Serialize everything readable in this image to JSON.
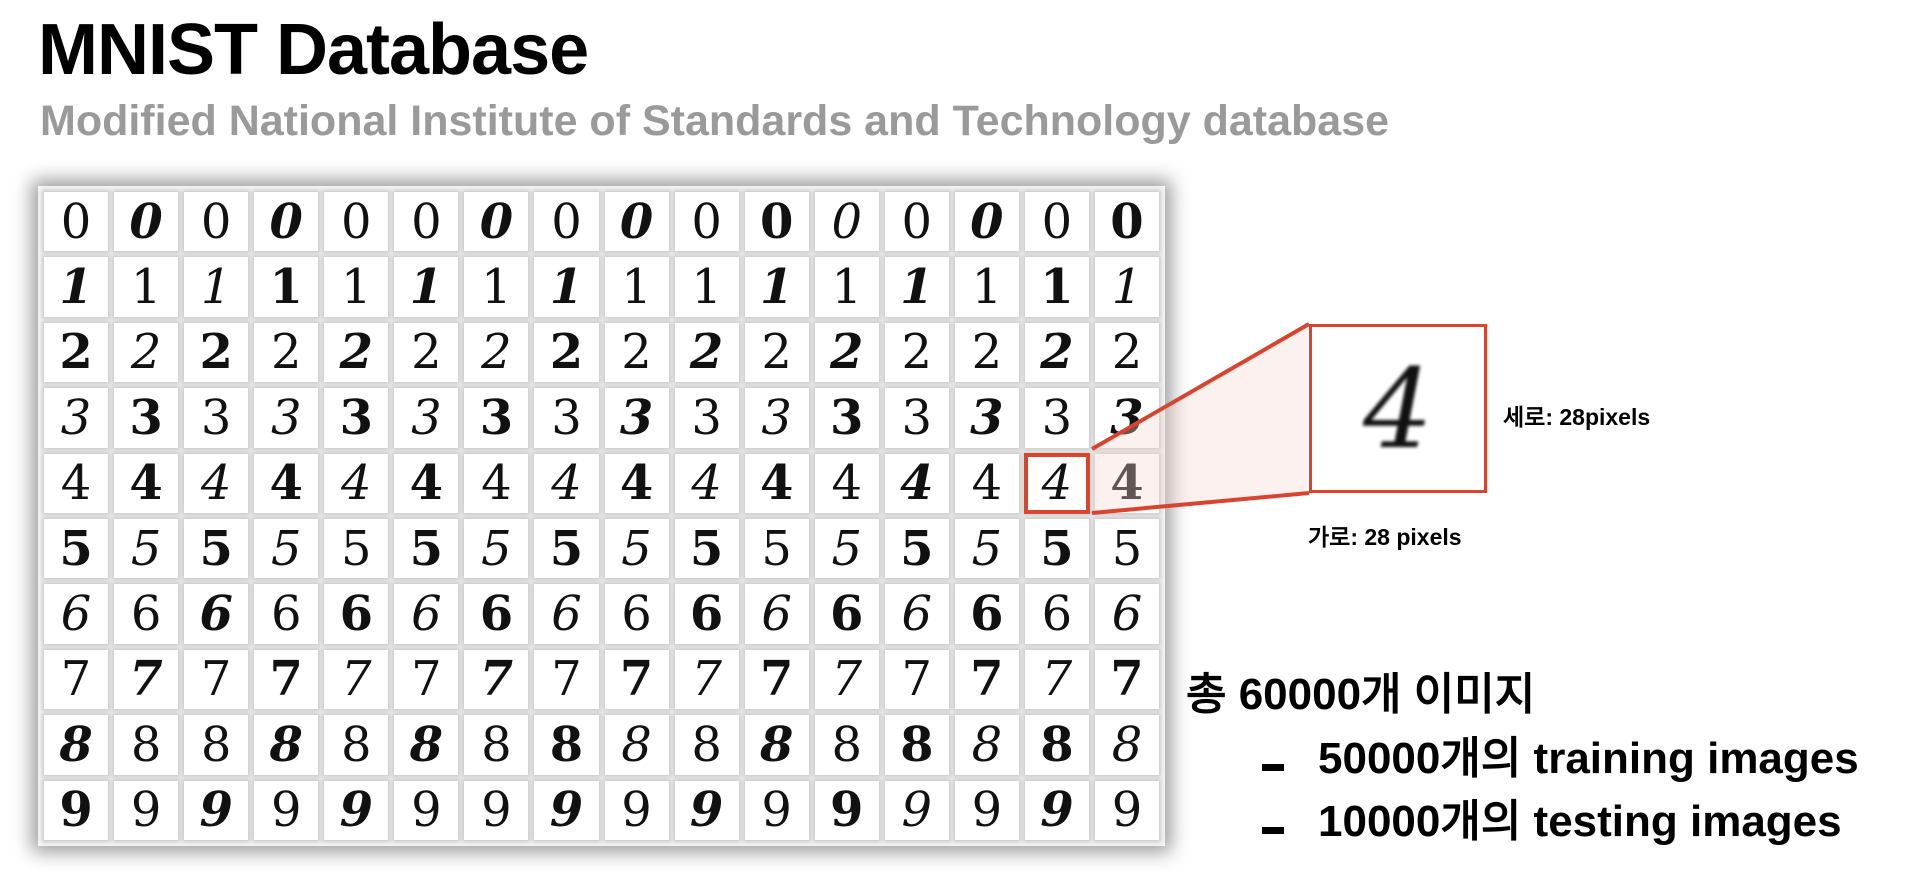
{
  "title": "MNIST Database",
  "subtitle": "Modified National Institute of Standards and Technology database",
  "grid": {
    "rows": [
      [
        "0",
        "0",
        "0",
        "0",
        "0",
        "0",
        "0",
        "0",
        "0",
        "0",
        "0",
        "0",
        "0",
        "0",
        "0",
        "0"
      ],
      [
        "1",
        "1",
        "1",
        "1",
        "1",
        "1",
        "1",
        "1",
        "1",
        "1",
        "1",
        "1",
        "1",
        "1",
        "1",
        "1"
      ],
      [
        "2",
        "2",
        "2",
        "2",
        "2",
        "2",
        "2",
        "2",
        "2",
        "2",
        "2",
        "2",
        "2",
        "2",
        "2",
        "2"
      ],
      [
        "3",
        "3",
        "3",
        "3",
        "3",
        "3",
        "3",
        "3",
        "3",
        "3",
        "3",
        "3",
        "3",
        "3",
        "3",
        "3"
      ],
      [
        "4",
        "4",
        "4",
        "4",
        "4",
        "4",
        "4",
        "4",
        "4",
        "4",
        "4",
        "4",
        "4",
        "4",
        "4",
        "4"
      ],
      [
        "5",
        "5",
        "5",
        "5",
        "5",
        "5",
        "5",
        "5",
        "5",
        "5",
        "5",
        "5",
        "5",
        "5",
        "5",
        "5"
      ],
      [
        "6",
        "6",
        "6",
        "6",
        "6",
        "6",
        "6",
        "6",
        "6",
        "6",
        "6",
        "6",
        "6",
        "6",
        "6",
        "6"
      ],
      [
        "7",
        "7",
        "7",
        "7",
        "7",
        "7",
        "7",
        "7",
        "7",
        "7",
        "7",
        "7",
        "7",
        "7",
        "7",
        "7"
      ],
      [
        "8",
        "8",
        "8",
        "8",
        "8",
        "8",
        "8",
        "8",
        "8",
        "8",
        "8",
        "8",
        "8",
        "8",
        "8",
        "8"
      ],
      [
        "9",
        "9",
        "9",
        "9",
        "9",
        "9",
        "9",
        "9",
        "9",
        "9",
        "9",
        "9",
        "9",
        "9",
        "9",
        "9"
      ]
    ],
    "highlight_color": "#d9442f"
  },
  "zoom": {
    "digit": "4",
    "height_label": "세로: 28pixels",
    "width_label": "가로: 28 pixels"
  },
  "summary": {
    "total": "총 60000개 이미지",
    "training": "50000개의 training images",
    "testing": "10000개의 testing images"
  }
}
